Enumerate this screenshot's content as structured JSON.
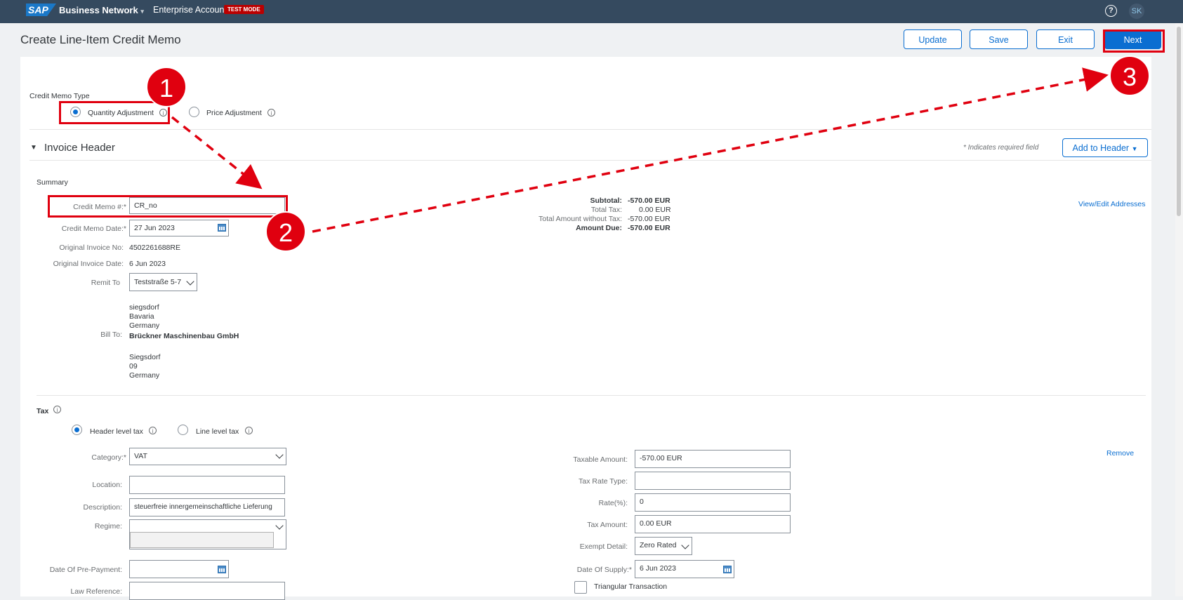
{
  "shell": {
    "logo": "SAP",
    "product": "Business Network",
    "account": "Enterprise Account",
    "mode_badge": "TEST MODE",
    "help": "?",
    "user_initials": "SK"
  },
  "page": {
    "title": "Create Line-Item Credit Memo",
    "buttons": {
      "update": "Update",
      "save": "Save",
      "exit": "Exit",
      "next": "Next"
    }
  },
  "credit_memo_type": {
    "label": "Credit Memo Type",
    "options": [
      "Quantity Adjustment",
      "Price Adjustment"
    ],
    "selected": "Quantity Adjustment"
  },
  "invoice_header": {
    "title": "Invoice Header",
    "required_note": "* Indicates required field",
    "add_button": "Add to Header",
    "summary_label": "Summary",
    "view_edit_addresses": "View/Edit Addresses",
    "fields": {
      "credit_memo_no_label": "Credit Memo #:*",
      "credit_memo_no_value": "CR_no",
      "credit_memo_date_label": "Credit Memo Date:*",
      "credit_memo_date_value": "27 Jun 2023",
      "original_invoice_no_label": "Original Invoice No:",
      "original_invoice_no_value": "4502261688RE",
      "original_invoice_date_label": "Original Invoice Date:",
      "original_invoice_date_value": "6 Jun 2023",
      "remit_to_label": "Remit To",
      "remit_to_value": "Teststraße 5-7",
      "remit_address": [
        "siegsdorf",
        "Bavaria",
        "Germany"
      ],
      "bill_to_label": "Bill To:",
      "bill_to_name": "Brückner Maschinenbau GmbH",
      "bill_address": [
        "Siegsdorf",
        "09",
        "Germany"
      ]
    },
    "totals": {
      "subtotal_label": "Subtotal:",
      "subtotal_value": "-570.00 EUR",
      "total_tax_label": "Total Tax:",
      "total_tax_value": "0.00 EUR",
      "total_wo_tax_label": "Total Amount without Tax:",
      "total_wo_tax_value": "-570.00 EUR",
      "amount_due_label": "Amount Due:",
      "amount_due_value": "-570.00 EUR"
    }
  },
  "tax": {
    "label": "Tax",
    "options": [
      "Header level tax",
      "Line level tax"
    ],
    "selected": "Header level tax",
    "remove": "Remove",
    "category_label": "Category:*",
    "category_value": "VAT",
    "location_label": "Location:",
    "location_value": "",
    "description_label": "Description:",
    "description_value": "steuerfreie innergemeinschaftliche Lieferung",
    "regime_label": "Regime:",
    "prepayment_label": "Date Of Pre-Payment:",
    "law_reference_label": "Law Reference:",
    "taxable_amount_label": "Taxable Amount:",
    "taxable_amount_value": "-570.00 EUR",
    "tax_rate_type_label": "Tax Rate Type:",
    "tax_rate_type_value": "",
    "rate_label": "Rate(%):",
    "rate_value": "0",
    "tax_amount_label": "Tax Amount:",
    "tax_amount_value": "0.00 EUR",
    "exempt_detail_label": "Exempt Detail:",
    "exempt_detail_value": "Zero Rated",
    "date_of_supply_label": "Date Of Supply:*",
    "date_of_supply_value": "6 Jun 2023",
    "triangular_label": "Triangular Transaction"
  },
  "annotations": {
    "step1": "1",
    "step2": "2",
    "step3": "3",
    "color": "#e0000f"
  }
}
